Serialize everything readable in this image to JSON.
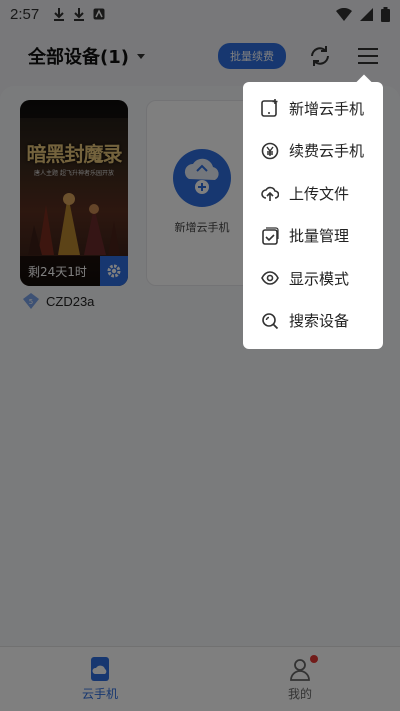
{
  "status_bar": {
    "time": "2:57",
    "left_icons": [
      "download-icon",
      "download-icon",
      "app-notification-icon"
    ],
    "right_icons": [
      "wifi-icon",
      "signal-icon",
      "battery-icon"
    ]
  },
  "header": {
    "title": "全部设备(1)",
    "batch_button": "批量续费",
    "icons": [
      "refresh-icon",
      "menu-icon"
    ]
  },
  "devices": [
    {
      "game_title": "暗黑封魔录",
      "game_subtitle": "唐人主题 超飞升神者乐园开放",
      "remaining": "剩24天1时",
      "name": "CZD23a"
    }
  ],
  "add_card": {
    "label": "新增云手机"
  },
  "menu": {
    "items": [
      {
        "label": "新增云手机",
        "icon": "add-phone-icon"
      },
      {
        "label": "续费云手机",
        "icon": "renew-icon"
      },
      {
        "label": "上传文件",
        "icon": "upload-cloud-icon"
      },
      {
        "label": "批量管理",
        "icon": "batch-check-icon"
      },
      {
        "label": "显示模式",
        "icon": "eye-icon"
      },
      {
        "label": "搜索设备",
        "icon": "search-device-icon"
      }
    ]
  },
  "bottom_nav": {
    "items": [
      {
        "label": "云手机",
        "icon": "cloud-phone-icon",
        "active": true
      },
      {
        "label": "我的",
        "icon": "user-icon",
        "active": false
      }
    ]
  },
  "colors": {
    "accent": "#2f6fe0",
    "badge_red": "#e53935",
    "overlay": "rgba(0,0,0,0.5)"
  }
}
